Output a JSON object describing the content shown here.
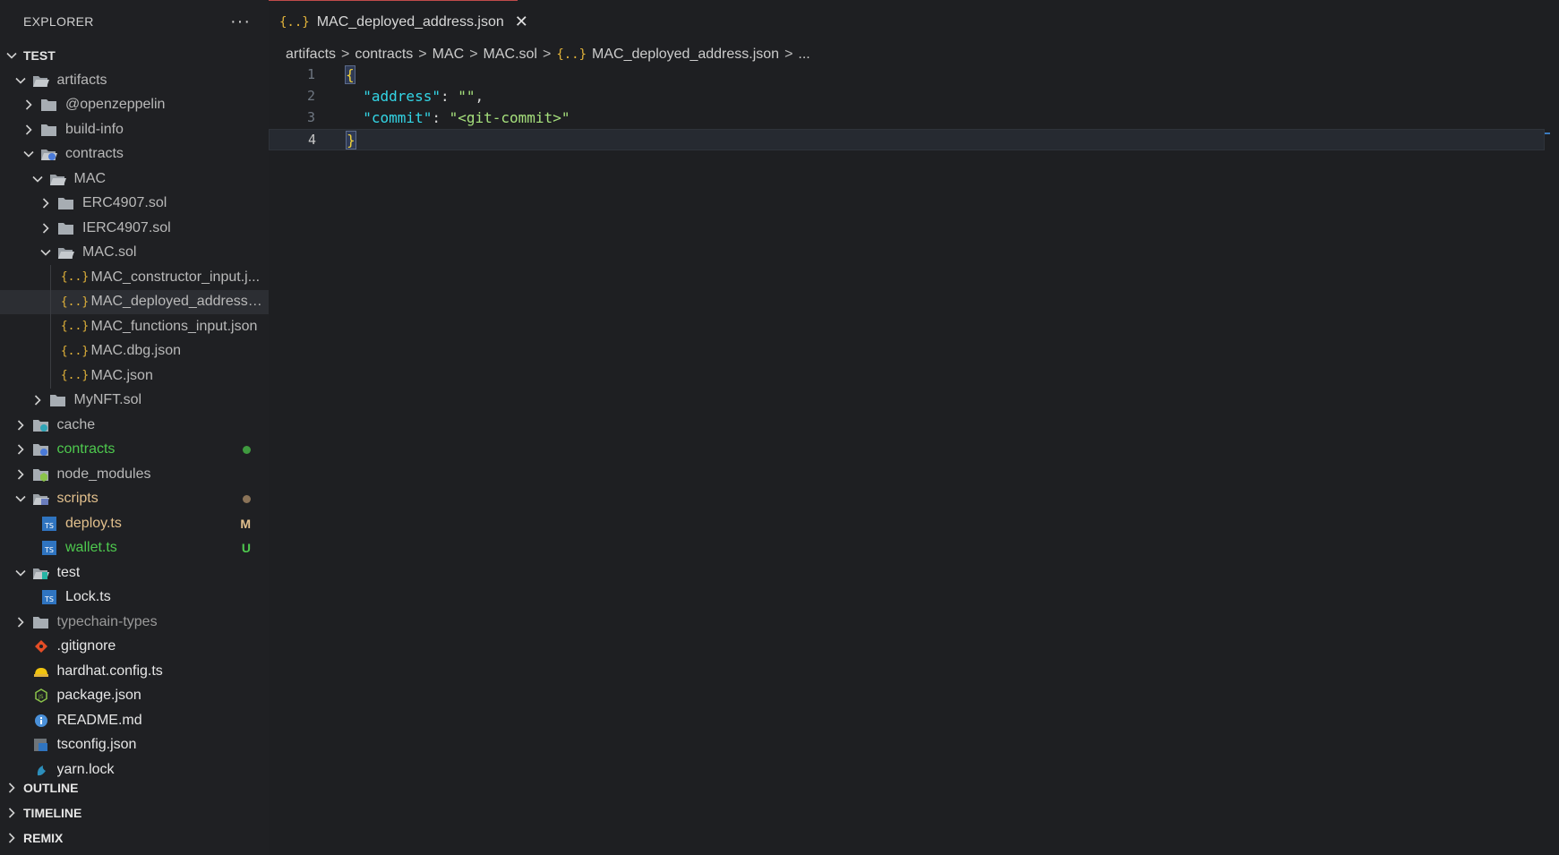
{
  "sidebar": {
    "header_title": "EXPLORER",
    "more_label": "···",
    "root_title": "TEST",
    "tree": [
      {
        "label": "artifacts",
        "depth": 1,
        "chevron": "down",
        "icon": "folder-open",
        "color": "#b9b9b9"
      },
      {
        "label": "@openzeppelin",
        "depth": 2,
        "chevron": "right",
        "icon": "folder",
        "color": "#b9b9b9"
      },
      {
        "label": "build-info",
        "depth": 2,
        "chevron": "right",
        "icon": "folder",
        "color": "#b9b9b9"
      },
      {
        "label": "contracts",
        "depth": 2,
        "chevron": "down",
        "icon": "folder-contracts-open",
        "color": "#b9b9b9"
      },
      {
        "label": "MAC",
        "depth": 3,
        "chevron": "down",
        "icon": "folder-open",
        "color": "#b9b9b9"
      },
      {
        "label": "ERC4907.sol",
        "depth": 4,
        "chevron": "right",
        "icon": "folder",
        "color": "#b9b9b9"
      },
      {
        "label": "IERC4907.sol",
        "depth": 4,
        "chevron": "right",
        "icon": "folder",
        "color": "#b9b9b9"
      },
      {
        "label": "MAC.sol",
        "depth": 4,
        "chevron": "down",
        "icon": "folder-open",
        "color": "#b9b9b9"
      },
      {
        "label": "MAC_constructor_input.j...",
        "depth": 5,
        "chevron": "none",
        "icon": "json",
        "color": "#b9b9b9"
      },
      {
        "label": "MAC_deployed_address....",
        "depth": 5,
        "chevron": "none",
        "icon": "json",
        "color": "#b9b9b9",
        "selected": true
      },
      {
        "label": "MAC_functions_input.json",
        "depth": 5,
        "chevron": "none",
        "icon": "json",
        "color": "#b9b9b9"
      },
      {
        "label": "MAC.dbg.json",
        "depth": 5,
        "chevron": "none",
        "icon": "json",
        "color": "#b9b9b9"
      },
      {
        "label": "MAC.json",
        "depth": 5,
        "chevron": "none",
        "icon": "json",
        "color": "#b9b9b9"
      },
      {
        "label": "MyNFT.sol",
        "depth": 3,
        "chevron": "right",
        "icon": "folder",
        "color": "#b9b9b9"
      },
      {
        "label": "cache",
        "depth": 1,
        "chevron": "right",
        "icon": "folder-cache",
        "color": "#b9b9b9"
      },
      {
        "label": "contracts",
        "depth": 1,
        "chevron": "right",
        "icon": "folder-contracts",
        "color": "#4ec94e",
        "badge_dot": "#3f9a3f"
      },
      {
        "label": "node_modules",
        "depth": 1,
        "chevron": "right",
        "icon": "folder-node",
        "color": "#b9b9b9"
      },
      {
        "label": "scripts",
        "depth": 1,
        "chevron": "down",
        "icon": "folder-scripts",
        "color": "#e2c08d",
        "badge_dot": "#8a7358"
      },
      {
        "label": "deploy.ts",
        "depth": 2,
        "chevron": "none",
        "icon": "ts",
        "color": "#e2c08d",
        "badge": "M",
        "badge_color": "#e2c08d"
      },
      {
        "label": "wallet.ts",
        "depth": 2,
        "chevron": "none",
        "icon": "ts",
        "color": "#4ec94e",
        "badge": "U",
        "badge_color": "#4ec94e"
      },
      {
        "label": "test",
        "depth": 1,
        "chevron": "down",
        "icon": "folder-test",
        "color": "#e6e6e6"
      },
      {
        "label": "Lock.ts",
        "depth": 2,
        "chevron": "none",
        "icon": "ts",
        "color": "#e6e6e6"
      },
      {
        "label": "typechain-types",
        "depth": 1,
        "chevron": "right",
        "icon": "folder",
        "color": "#9a9a9a"
      },
      {
        "label": ".gitignore",
        "depth": 1,
        "chevron": "none",
        "icon": "git",
        "color": "#e6e6e6"
      },
      {
        "label": "hardhat.config.ts",
        "depth": 1,
        "chevron": "none",
        "icon": "hardhat",
        "color": "#e6e6e6"
      },
      {
        "label": "package.json",
        "depth": 1,
        "chevron": "none",
        "icon": "node",
        "color": "#e6e6e6"
      },
      {
        "label": "README.md",
        "depth": 1,
        "chevron": "none",
        "icon": "info",
        "color": "#e6e6e6"
      },
      {
        "label": "tsconfig.json",
        "depth": 1,
        "chevron": "none",
        "icon": "tsconfig",
        "color": "#e6e6e6"
      },
      {
        "label": "yarn.lock",
        "depth": 1,
        "chevron": "none",
        "icon": "yarn",
        "color": "#e6e6e6"
      }
    ],
    "sections": [
      "OUTLINE",
      "TIMELINE",
      "REMIX"
    ]
  },
  "tab": {
    "icon_label": "{..}",
    "label": "MAC_deployed_address.json",
    "close_label": "✕"
  },
  "breadcrumb": {
    "parts": [
      "artifacts",
      "contracts",
      "MAC",
      "MAC.sol"
    ],
    "file_icon_label": "{..}",
    "file": "MAC_deployed_address.json",
    "sep": ">",
    "tail": "..."
  },
  "editor": {
    "line_numbers": [
      "1",
      "2",
      "3",
      "4"
    ],
    "lines": [
      {
        "open_brace": "{"
      },
      {
        "indent": "  ",
        "key": "\"address\"",
        "colon": ": ",
        "value": "\"\"",
        "comma": ","
      },
      {
        "indent": "  ",
        "key": "\"commit\"",
        "colon": ": ",
        "value": "\"<git-commit>\"",
        "comma": ""
      },
      {
        "close_brace": "}"
      }
    ]
  },
  "colors": {
    "background": "#1e1f22",
    "accent_tab_border": "#c04b4b",
    "json_icon": "#e2b33a",
    "modified": "#e2c08d",
    "untracked": "#4ec94e"
  }
}
